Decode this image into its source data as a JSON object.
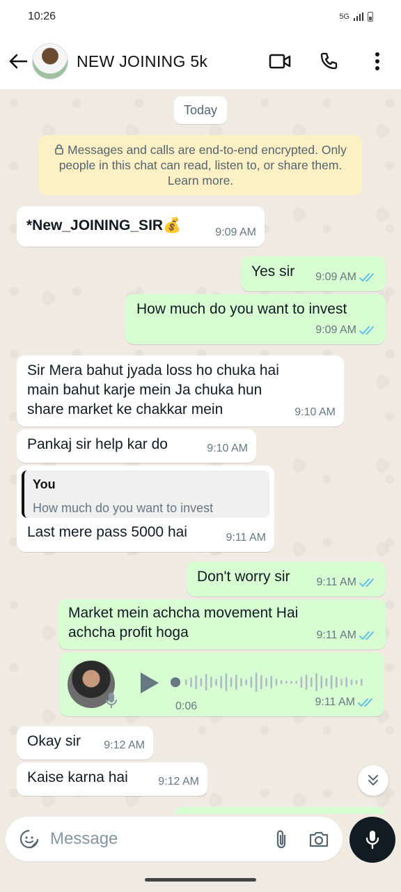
{
  "status_bar": {
    "time": "10:26",
    "network": "5G"
  },
  "header": {
    "title": "NEW JOINING 5k"
  },
  "chat": {
    "date_chip": "Today",
    "encryption_notice": "Messages and calls are end-to-end encrypted. Only people in this chat can read, listen to, or share them. Learn more.",
    "messages": [
      {
        "dir": "in",
        "text": "*New_JOINING_SIR💰",
        "time": "9:09 AM"
      },
      {
        "dir": "out",
        "text": "Yes sir",
        "time": "9:09 AM",
        "read": true
      },
      {
        "dir": "out",
        "text": "How much do you want to invest",
        "time": "9:09 AM",
        "read": true
      },
      {
        "dir": "in",
        "text": "Sir Mera bahut jyada loss ho chuka hai\nmain bahut karje mein Ja chuka hun\nshare market ke chakkar mein",
        "time": "9:10 AM"
      },
      {
        "dir": "in",
        "text": "Pankaj sir  help kar do",
        "time": "9:10 AM"
      },
      {
        "dir": "in",
        "reply_to": {
          "author": "You",
          "text": "How much do you want to invest"
        },
        "text": "Last mere pass 5000 hai",
        "time": "9:11 AM"
      },
      {
        "dir": "out",
        "text": "Don't worry sir",
        "time": "9:11 AM",
        "read": true
      },
      {
        "dir": "out",
        "text": "Market mein achcha movement Hai\nachcha profit hoga",
        "time": "9:11 AM",
        "read": true
      },
      {
        "dir": "out",
        "type": "voice",
        "duration": "0:06",
        "time": "9:11 AM",
        "read": true
      },
      {
        "dir": "in",
        "text": "Okay sir",
        "time": "9:12 AM"
      },
      {
        "dir": "in",
        "text": "Kaise karna hai",
        "time": "9:12 AM"
      }
    ]
  },
  "composer": {
    "placeholder": "Message"
  },
  "colors": {
    "outgoing": "#d9fdd3",
    "incoming": "#ffffff",
    "read_ticks": "#53bdeb",
    "notice": "#fdf0c4"
  }
}
